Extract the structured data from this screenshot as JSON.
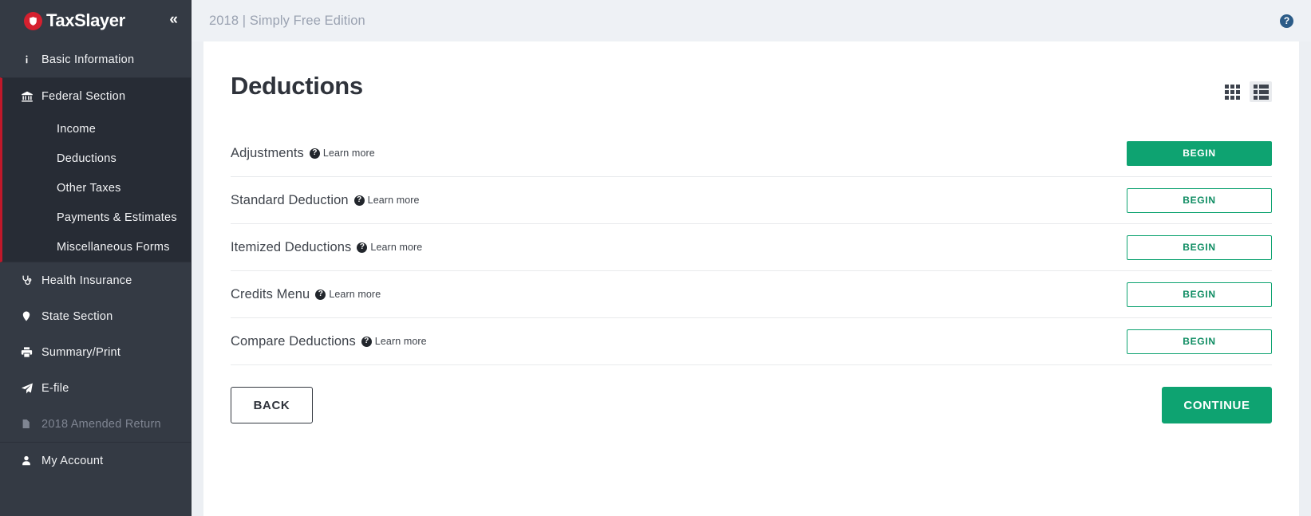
{
  "brand": {
    "name": "TaxSlayer",
    "logo_icon": "taxslayer-shield-icon",
    "collapse_icon": "«"
  },
  "sidebar": {
    "items": [
      {
        "label": "Basic Information",
        "icon": "info-icon",
        "state": "normal"
      },
      {
        "label": "Federal Section",
        "icon": "bank-icon",
        "state": "active"
      },
      {
        "label": "Health Insurance",
        "icon": "stethoscope-icon",
        "state": "normal"
      },
      {
        "label": "State Section",
        "icon": "map-pin-icon",
        "state": "normal"
      },
      {
        "label": "Summary/Print",
        "icon": "printer-icon",
        "state": "normal"
      },
      {
        "label": "E-file",
        "icon": "paper-plane-icon",
        "state": "normal"
      },
      {
        "label": "2018 Amended Return",
        "icon": "document-icon",
        "state": "disabled"
      },
      {
        "label": "My Account",
        "icon": "user-icon",
        "state": "normal"
      }
    ],
    "federal_subitems": [
      {
        "label": "Income"
      },
      {
        "label": "Deductions"
      },
      {
        "label": "Other Taxes"
      },
      {
        "label": "Payments & Estimates"
      },
      {
        "label": "Miscellaneous Forms"
      }
    ]
  },
  "topbar": {
    "title": "2018 | Simply Free Edition",
    "help_icon": "?"
  },
  "main": {
    "page_title": "Deductions",
    "view_toggles": {
      "grid_label": "grid-view",
      "list_label": "list-view",
      "active": "list-view"
    },
    "rows": [
      {
        "label": "Adjustments",
        "learn_more": "Learn more",
        "button": "BEGIN",
        "button_style": "filled"
      },
      {
        "label": "Standard Deduction",
        "learn_more": "Learn more",
        "button": "BEGIN",
        "button_style": "outline"
      },
      {
        "label": "Itemized Deductions",
        "learn_more": "Learn more",
        "button": "BEGIN",
        "button_style": "outline"
      },
      {
        "label": "Credits Menu",
        "learn_more": "Learn more",
        "button": "BEGIN",
        "button_style": "outline"
      },
      {
        "label": "Compare Deductions",
        "learn_more": "Learn more",
        "button": "BEGIN",
        "button_style": "outline"
      }
    ],
    "footer": {
      "back_label": "BACK",
      "continue_label": "CONTINUE"
    }
  },
  "colors": {
    "sidebar_bg": "#343a44",
    "sidebar_active_bg": "#272c35",
    "active_accent": "#c0182a",
    "brand_red": "#d5202f",
    "green": "#0ea371",
    "help_blue": "#2b5b87",
    "topbar_bg": "#eef1f5"
  }
}
